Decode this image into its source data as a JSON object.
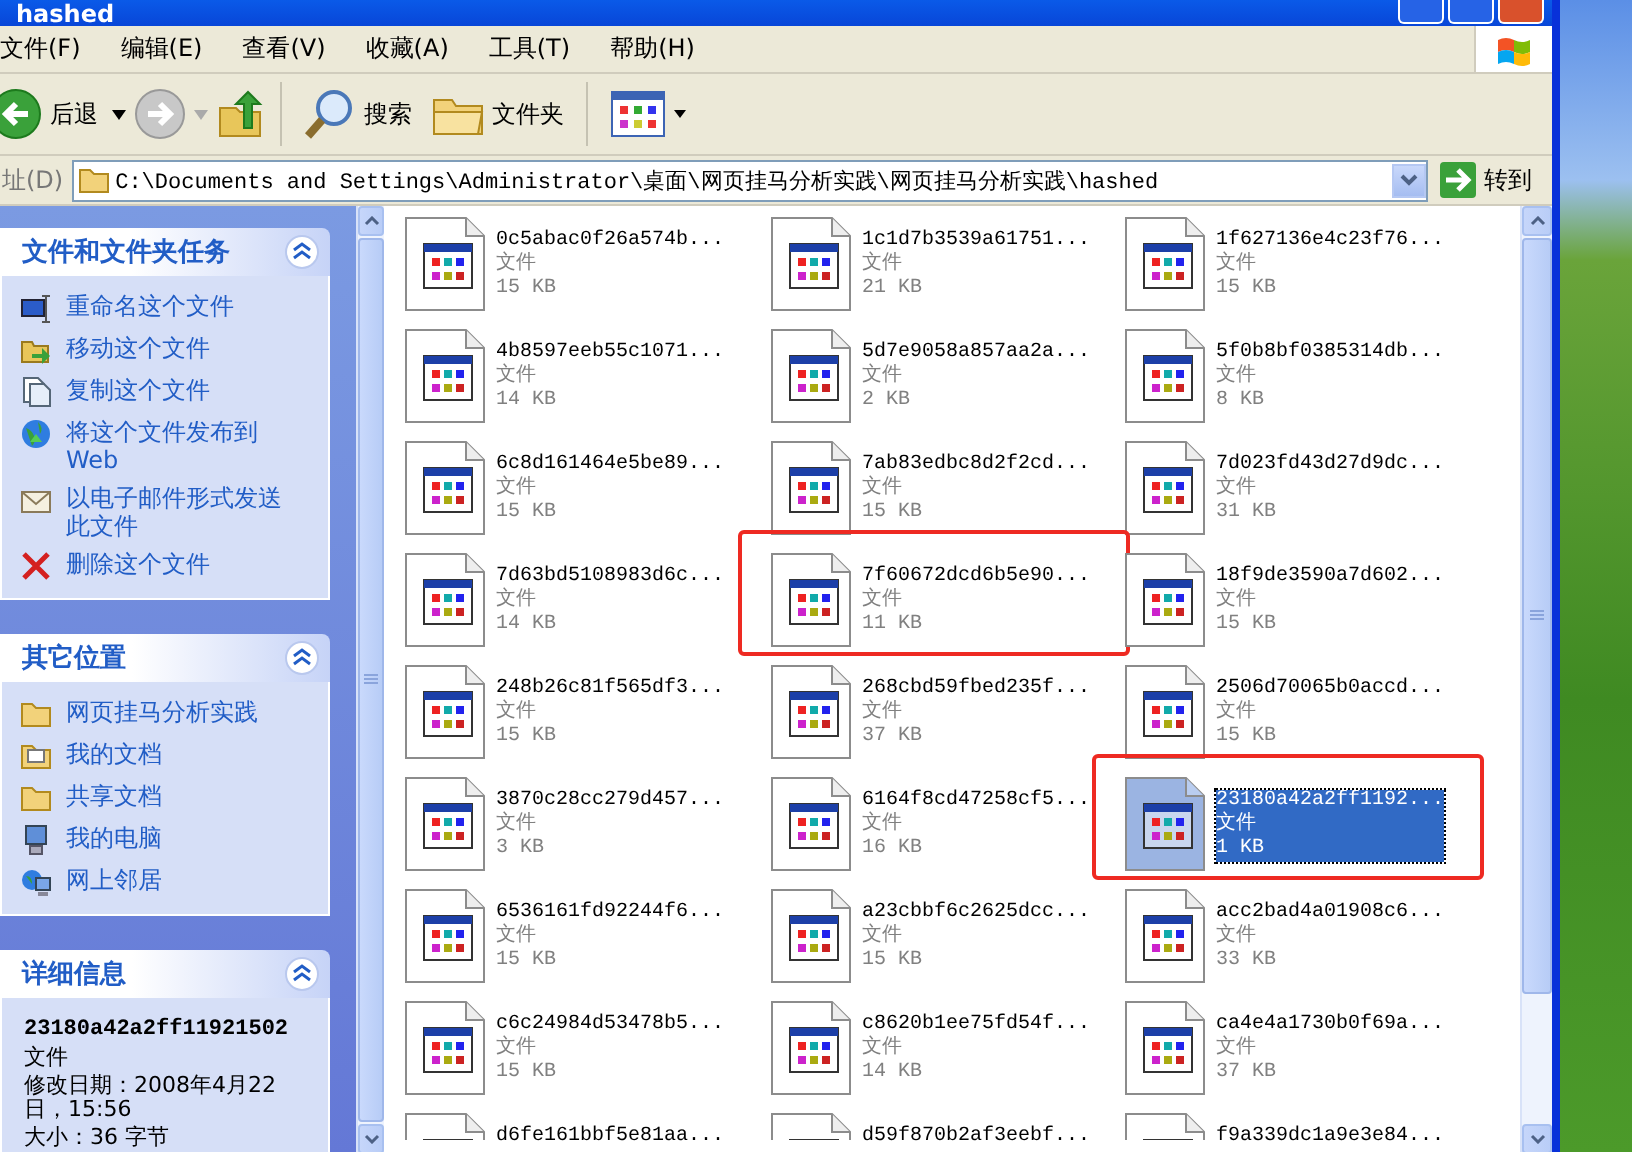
{
  "window": {
    "title": "hashed"
  },
  "menu": [
    {
      "label": "文件(F)"
    },
    {
      "label": "编辑(E)"
    },
    {
      "label": "查看(V)"
    },
    {
      "label": "收藏(A)"
    },
    {
      "label": "工具(T)"
    },
    {
      "label": "帮助(H)"
    }
  ],
  "toolbar": {
    "back": "后退",
    "search": "搜索",
    "folders": "文件夹"
  },
  "address": {
    "label": "址(D)",
    "value": "C:\\Documents and Settings\\Administrator\\桌面\\网页挂马分析实践\\网页挂马分析实践\\hashed",
    "go": "转到"
  },
  "task_panels": [
    {
      "title": "文件和文件夹任务",
      "expanded": true,
      "items": [
        {
          "label": "重命名这个文件",
          "kind": "rename"
        },
        {
          "label": "移动这个文件",
          "kind": "move"
        },
        {
          "label": "复制这个文件",
          "kind": "copy"
        },
        {
          "label": "将这个文件发布到 Web",
          "kind": "web"
        },
        {
          "label": "以电子邮件形式发送此文件",
          "kind": "mail"
        },
        {
          "label": "删除这个文件",
          "kind": "delete"
        }
      ]
    },
    {
      "title": "其它位置",
      "expanded": true,
      "items": [
        {
          "label": "网页挂马分析实践",
          "kind": "folder"
        },
        {
          "label": "我的文档",
          "kind": "documents"
        },
        {
          "label": "共享文档",
          "kind": "folder"
        },
        {
          "label": "我的电脑",
          "kind": "computer"
        },
        {
          "label": "网上邻居",
          "kind": "network"
        }
      ]
    }
  ],
  "details": {
    "title": "详细信息",
    "expanded": true,
    "name": "23180a42a2ff11921502",
    "type": "文件",
    "modified": "修改日期：2008年4月22日，15:56",
    "size": "大小：36 字节"
  },
  "files": [
    {
      "name": "0c5abac0f26a574b...",
      "type": "文件",
      "size": "15 KB",
      "selected": false,
      "annotated": false
    },
    {
      "name": "1c1d7b3539a61751...",
      "type": "文件",
      "size": "21 KB",
      "selected": false,
      "annotated": false
    },
    {
      "name": "1f627136e4c23f76...",
      "type": "文件",
      "size": "15 KB",
      "selected": false,
      "annotated": false
    },
    {
      "name": "4b8597eeb55c1071...",
      "type": "文件",
      "size": "14 KB",
      "selected": false,
      "annotated": false
    },
    {
      "name": "5d7e9058a857aa2a...",
      "type": "文件",
      "size": "2 KB",
      "selected": false,
      "annotated": false
    },
    {
      "name": "5f0b8bf0385314db...",
      "type": "文件",
      "size": "8 KB",
      "selected": false,
      "annotated": false
    },
    {
      "name": "6c8d161464e5be89...",
      "type": "文件",
      "size": "15 KB",
      "selected": false,
      "annotated": false
    },
    {
      "name": "7ab83edbc8d2f2cd...",
      "type": "文件",
      "size": "15 KB",
      "selected": false,
      "annotated": false
    },
    {
      "name": "7d023fd43d27d9dc...",
      "type": "文件",
      "size": "31 KB",
      "selected": false,
      "annotated": false
    },
    {
      "name": "7d63bd5108983d6c...",
      "type": "文件",
      "size": "14 KB",
      "selected": false,
      "annotated": false
    },
    {
      "name": "7f60672dcd6b5e90...",
      "type": "文件",
      "size": "11 KB",
      "selected": false,
      "annotated": true
    },
    {
      "name": "18f9de3590a7d602...",
      "type": "文件",
      "size": "15 KB",
      "selected": false,
      "annotated": false
    },
    {
      "name": "248b26c81f565df3...",
      "type": "文件",
      "size": "15 KB",
      "selected": false,
      "annotated": false
    },
    {
      "name": "268cbd59fbed235f...",
      "type": "文件",
      "size": "37 KB",
      "selected": false,
      "annotated": false
    },
    {
      "name": "2506d70065b0accd...",
      "type": "文件",
      "size": "15 KB",
      "selected": false,
      "annotated": false
    },
    {
      "name": "3870c28cc279d457...",
      "type": "文件",
      "size": "3 KB",
      "selected": false,
      "annotated": false
    },
    {
      "name": "6164f8cd47258cf5...",
      "type": "文件",
      "size": "16 KB",
      "selected": false,
      "annotated": false
    },
    {
      "name": "23180a42a2ff1192...",
      "type": "文件",
      "size": "1 KB",
      "selected": true,
      "annotated": true
    },
    {
      "name": "6536161fd92244f6...",
      "type": "文件",
      "size": "15 KB",
      "selected": false,
      "annotated": false
    },
    {
      "name": "a23cbbf6c2625dcc...",
      "type": "文件",
      "size": "15 KB",
      "selected": false,
      "annotated": false
    },
    {
      "name": "acc2bad4a01908c6...",
      "type": "文件",
      "size": "33 KB",
      "selected": false,
      "annotated": false
    },
    {
      "name": "c6c24984d53478b5...",
      "type": "文件",
      "size": "15 KB",
      "selected": false,
      "annotated": false
    },
    {
      "name": "c8620b1ee75fd54f...",
      "type": "文件",
      "size": "14 KB",
      "selected": false,
      "annotated": false
    },
    {
      "name": "ca4e4a1730b0f69a...",
      "type": "文件",
      "size": "37 KB",
      "selected": false,
      "annotated": false
    },
    {
      "name": "d6fe161bbf5e81aa...",
      "selected": false,
      "annotated": false
    },
    {
      "name": "d59f870b2af3eebf...",
      "selected": false,
      "annotated": false
    },
    {
      "name": "f9a339dc1a9e3e84...",
      "selected": false,
      "annotated": false
    }
  ]
}
